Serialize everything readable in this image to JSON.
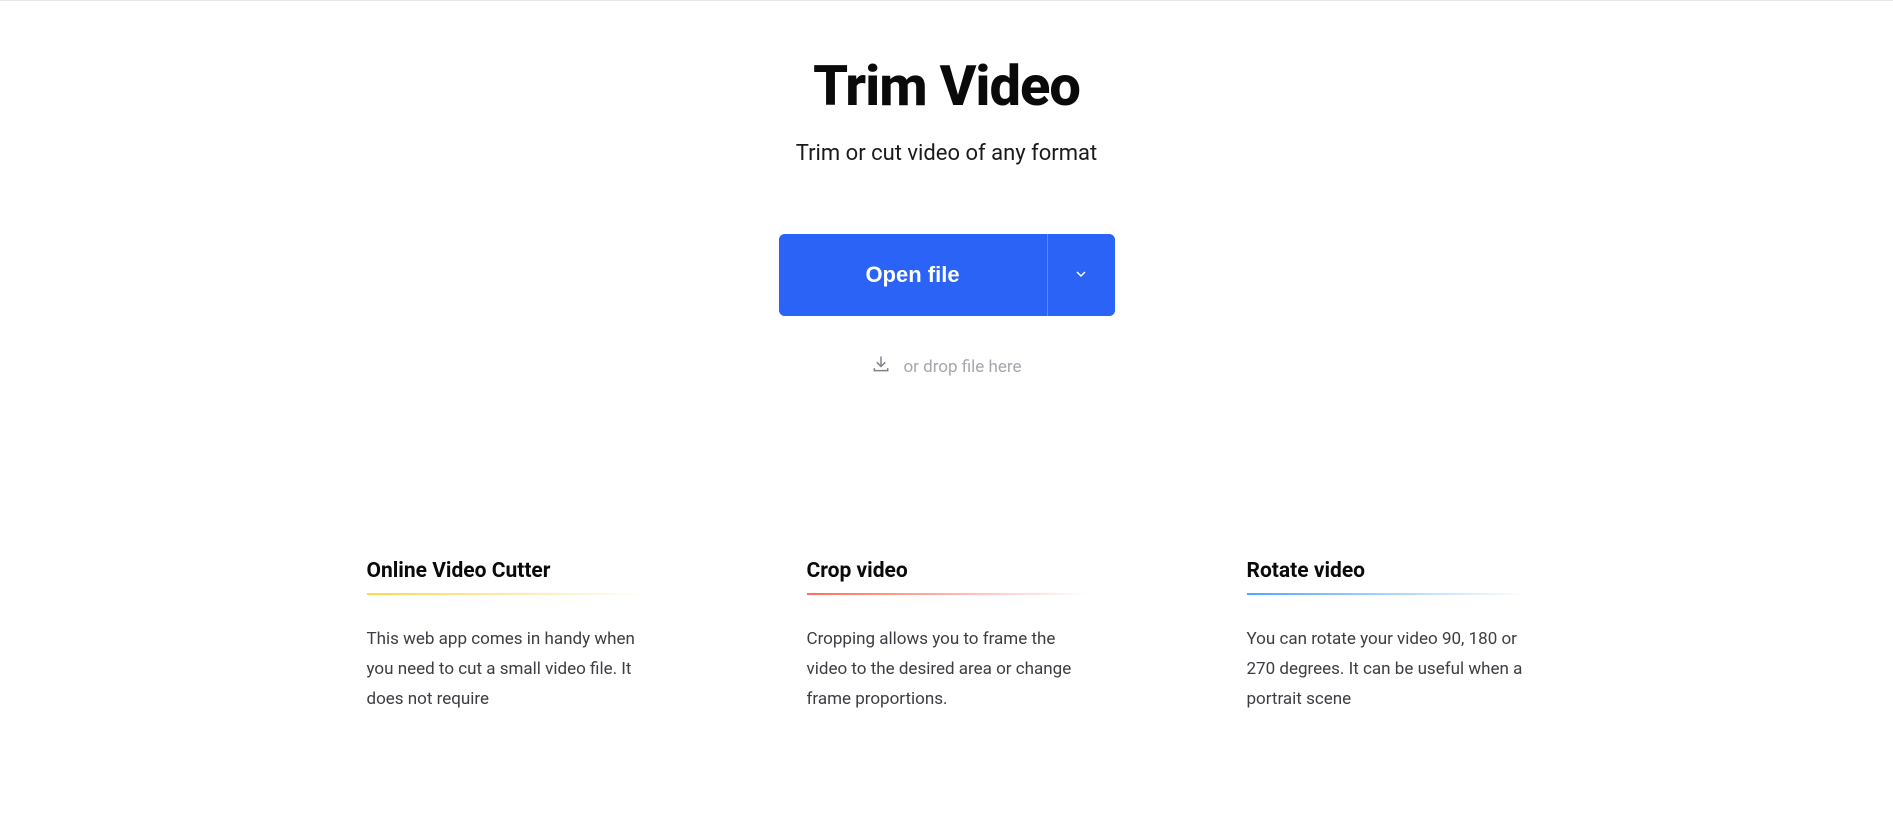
{
  "hero": {
    "title": "Trim Video",
    "subtitle": "Trim or cut video of any format",
    "open_label": "Open file",
    "drop_hint": "or drop file here"
  },
  "features": [
    {
      "title": "Online Video Cutter",
      "body": "This web app comes in handy when you need to cut a small video file. It does not require"
    },
    {
      "title": "Crop video",
      "body": "Cropping allows you to frame the video to the desired area or change frame proportions."
    },
    {
      "title": "Rotate video",
      "body": "You can rotate your video 90, 180 or 270 degrees. It can be useful when a portrait scene"
    }
  ],
  "colors": {
    "primary": "#2a63f6"
  }
}
